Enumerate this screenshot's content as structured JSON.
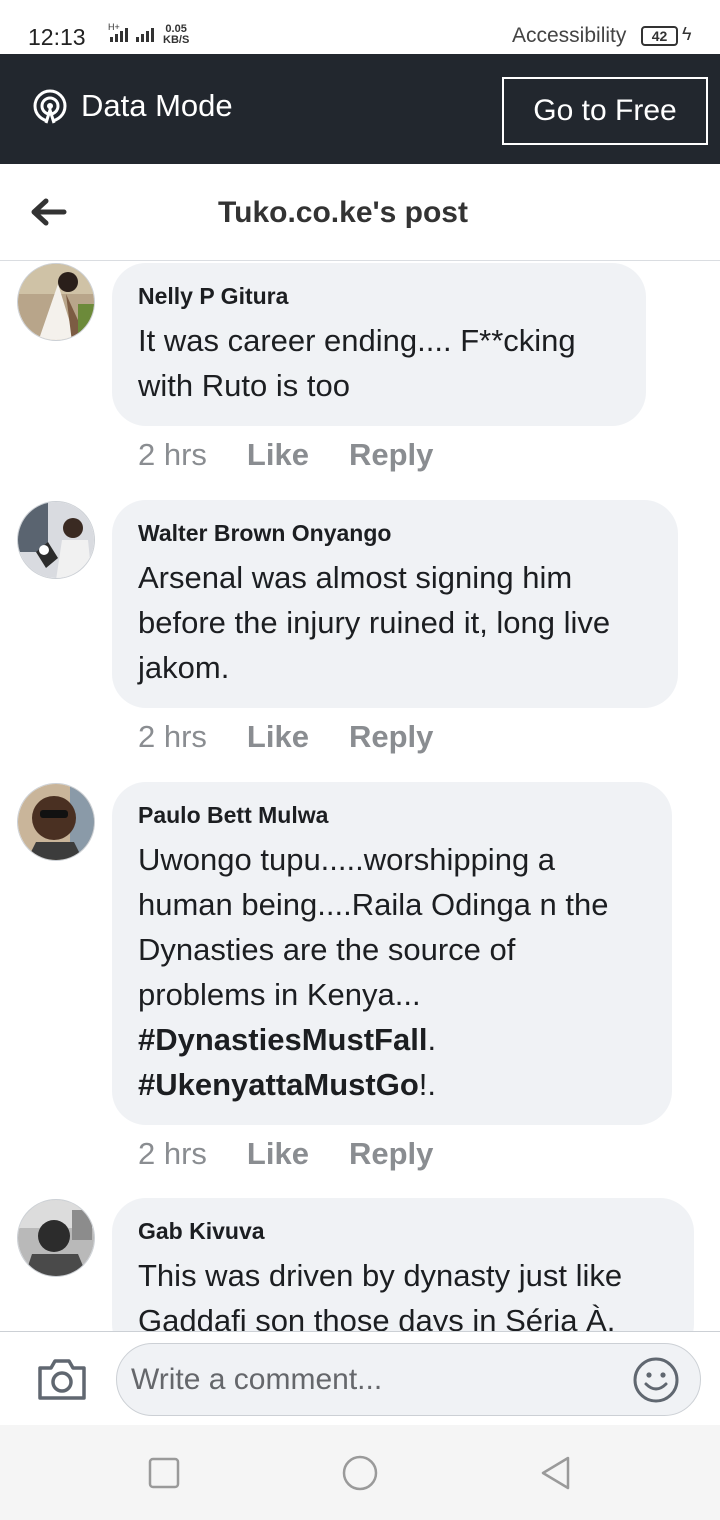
{
  "status_bar": {
    "time": "12:13",
    "network": "H+",
    "speed_value": "0.05",
    "speed_unit": "KB/S",
    "accessibility_label": "Accessibility",
    "battery": "42"
  },
  "banner": {
    "label": "Data Mode",
    "button_label": "Go to Free"
  },
  "header": {
    "title": "Tuko.co.ke's post"
  },
  "comments": [
    {
      "author": "Nelly P Gitura",
      "text": "It was career ending.... F**cking with Ruto is too",
      "time": "2 hrs",
      "like": "Like",
      "reply": "Reply"
    },
    {
      "author": "Walter Brown Onyango",
      "text": "Arsenal was almost signing him before the injury ruined it, long live jakom.",
      "time": "2 hrs",
      "like": "Like",
      "reply": "Reply"
    },
    {
      "author": "Paulo Bett Mulwa",
      "text_lines": [
        "Uwongo tupu.....worshipping a",
        "human being....Raila Odinga n the",
        "Dynasties are the source of",
        "problems in Kenya..."
      ],
      "hashtag1": "#DynastiesMustFall",
      "hashtag1_suffix": ".",
      "hashtag2": "#UkenyattaMustGo",
      "hashtag2_suffix": "!.",
      "time": "2 hrs",
      "like": "Like",
      "reply": "Reply"
    },
    {
      "author": "Gab Kivuva",
      "text": "This was driven by dynasty just like Gaddafi son those days in Séria À."
    }
  ],
  "composer": {
    "placeholder": "Write a comment..."
  },
  "colors": {
    "banner_bg": "#22272e",
    "bubble_bg": "#f0f2f5",
    "meta_text": "#8a8d91"
  }
}
